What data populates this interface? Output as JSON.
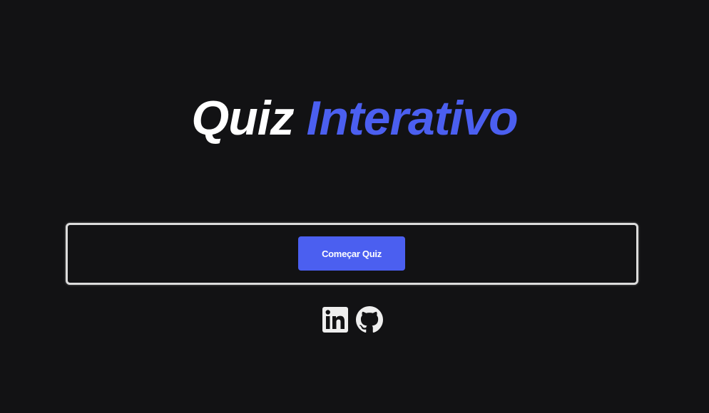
{
  "header": {
    "title_part1": "Quiz",
    "title_part2": "Interativo"
  },
  "main": {
    "start_button_label": "Começar Quiz"
  },
  "socials": [
    {
      "icon": "linkedin-icon",
      "label": "LinkedIn"
    },
    {
      "icon": "github-icon",
      "label": "GitHub"
    }
  ],
  "colors": {
    "background": "#121214",
    "accent": "#4b5ff0",
    "title_white": "#ffffff",
    "card_border": "#dcdcdc"
  }
}
